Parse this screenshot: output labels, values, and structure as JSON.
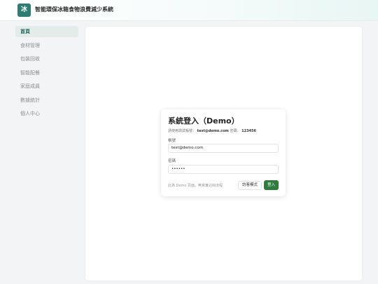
{
  "header": {
    "logo_char": "冰",
    "title": "智能環保冰箱食物浪費減少系統"
  },
  "sidebar": {
    "items": [
      {
        "label": "首頁",
        "active": true
      },
      {
        "label": "食材管理",
        "active": false
      },
      {
        "label": "包裝回收",
        "active": false
      },
      {
        "label": "智能配餐",
        "active": false
      },
      {
        "label": "家庭成員",
        "active": false
      },
      {
        "label": "數據統計",
        "active": false
      },
      {
        "label": "個人中心",
        "active": false
      }
    ]
  },
  "login": {
    "title": "系統登入（Demo）",
    "hint_prefix": "請使用測試帳號：",
    "hint_account": "test@demo.com",
    "hint_password_label": "密碼：",
    "hint_password": "123456",
    "account_label": "帳號",
    "account_value": "test@demo.com",
    "password_label": "密碼",
    "password_value": "••••••",
    "note": "此為 Demo 頁面，無真實註冊流程",
    "guest_button": "訪客模式",
    "login_button": "登入"
  },
  "colors": {
    "brand": "#2f7c73",
    "primary_button": "#2e7d3c",
    "active_nav_bg": "#e4ece9"
  }
}
